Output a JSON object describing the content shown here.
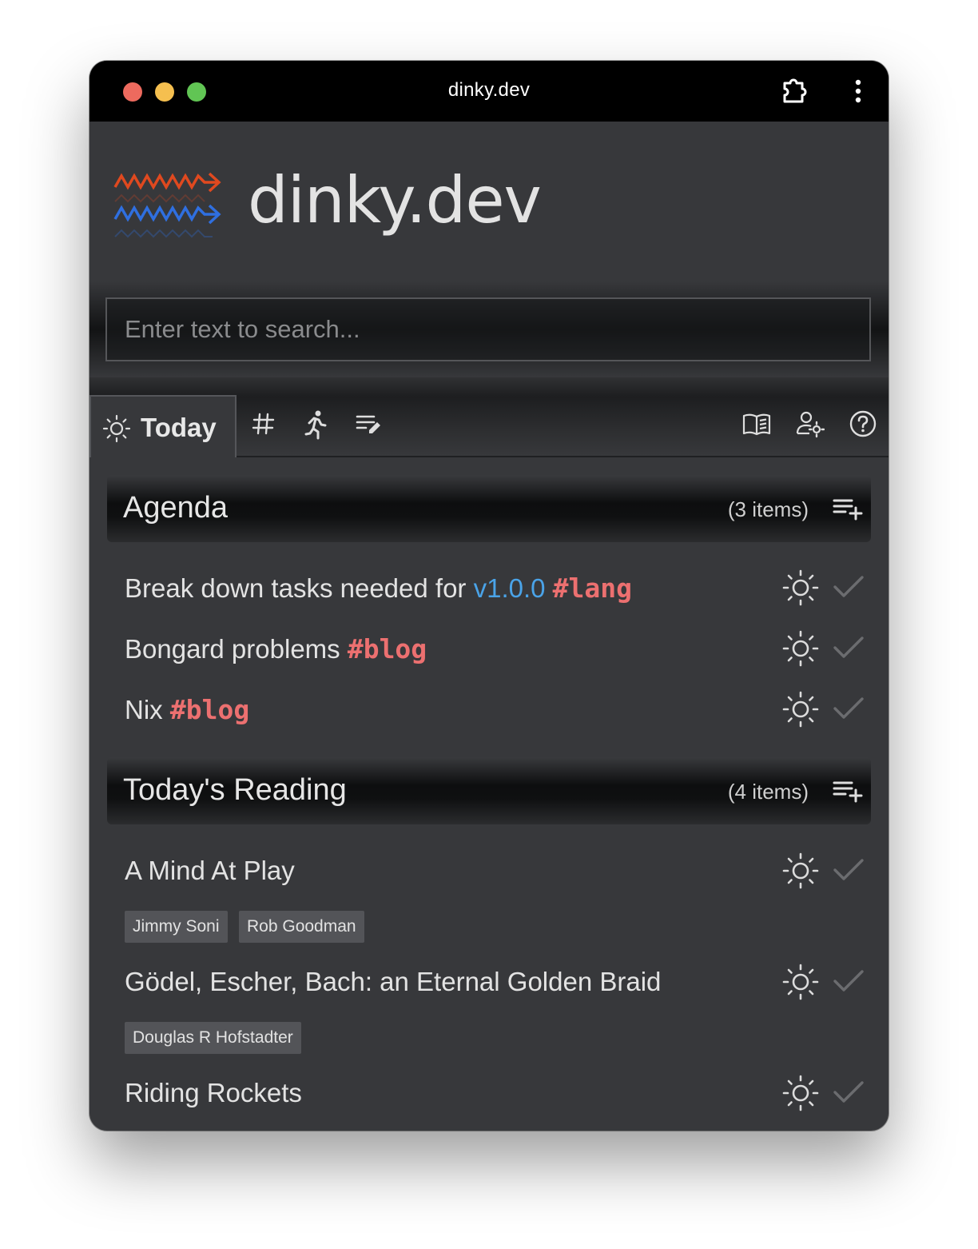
{
  "window": {
    "title": "dinky.dev"
  },
  "titlebar": {
    "icons": [
      "extension-icon",
      "more-vert-icon"
    ]
  },
  "header": {
    "app_name": "dinky.dev"
  },
  "search": {
    "placeholder": "Enter text to search..."
  },
  "toolbar": {
    "active_tab": {
      "label": "Today",
      "icon": "sun-icon"
    },
    "left_icons": [
      "hashtag-icon",
      "running-person-icon",
      "edit-list-icon"
    ],
    "right_icons": [
      "book-icon",
      "user-settings-icon",
      "help-icon"
    ]
  },
  "colors": {
    "accent_version": "#4aa3e8",
    "accent_tag": "#ec7070",
    "logo_red": "#e0491f",
    "logo_blue": "#2f6fe0"
  },
  "agenda": {
    "title": "Agenda",
    "count": "(3 items)",
    "items": [
      {
        "text": "Break down tasks needed for ",
        "version": "v1.0.0",
        "tag": "#lang"
      },
      {
        "text": "Bongard problems ",
        "tag": "#blog"
      },
      {
        "text": "Nix ",
        "tag": "#blog"
      }
    ]
  },
  "reading": {
    "title": "Today's Reading",
    "count": "(4 items)",
    "items": [
      {
        "title": "A Mind At Play",
        "authors": [
          "Jimmy Soni",
          "Rob Goodman"
        ]
      },
      {
        "title": "Gödel, Escher, Bach: an Eternal Golden Braid",
        "authors": [
          "Douglas R Hofstadter"
        ]
      },
      {
        "title": "Riding Rockets",
        "authors": []
      }
    ]
  }
}
